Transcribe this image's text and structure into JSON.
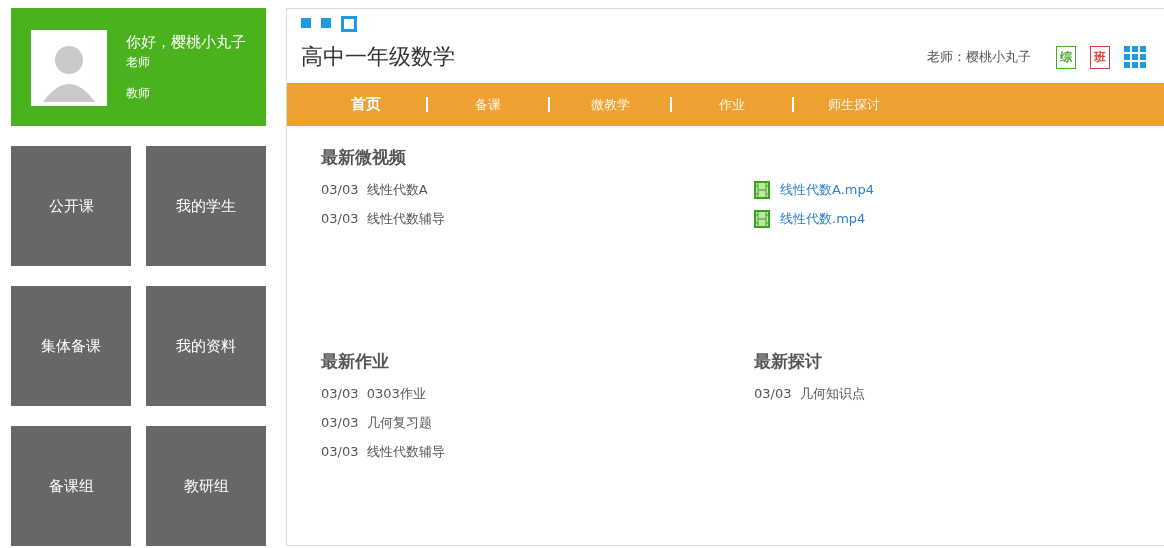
{
  "profile": {
    "greeting": "你好，樱桃小丸子",
    "title": "老师",
    "role": "教师"
  },
  "tiles": [
    {
      "label": "公开课"
    },
    {
      "label": "我的学生"
    },
    {
      "label": "集体备课"
    },
    {
      "label": "我的资料"
    },
    {
      "label": "备课组"
    },
    {
      "label": "教研组"
    }
  ],
  "page_dots": [
    {
      "selected": false
    },
    {
      "selected": false
    },
    {
      "selected": true
    }
  ],
  "course_title": "高中一年级数学",
  "teacher": "老师：樱桃小丸子",
  "badges": [
    {
      "label": "综",
      "color": "#4aa82b"
    },
    {
      "label": "班",
      "color": "#d9413a"
    }
  ],
  "nav": [
    {
      "label": "首页",
      "selected": true
    },
    {
      "label": "备课",
      "selected": false
    },
    {
      "label": "微教学",
      "selected": false
    },
    {
      "label": "作业",
      "selected": false
    },
    {
      "label": "师生探讨",
      "selected": false
    }
  ],
  "videos": {
    "heading": "最新微视频",
    "items": [
      {
        "date": "03/03",
        "title": "线性代数A"
      },
      {
        "date": "03/03",
        "title": "线性代数辅导"
      }
    ],
    "files": [
      "线性代数A.mp4",
      "线性代数.mp4"
    ]
  },
  "homework": {
    "heading": "最新作业",
    "items": [
      {
        "date": "03/03",
        "title": "0303作业"
      },
      {
        "date": "03/03",
        "title": "几何复习题"
      },
      {
        "date": "03/03",
        "title": "线性代数辅导"
      }
    ]
  },
  "discussion": {
    "heading": "最新探讨",
    "items": [
      {
        "date": "03/03",
        "title": "几何知识点"
      }
    ]
  }
}
